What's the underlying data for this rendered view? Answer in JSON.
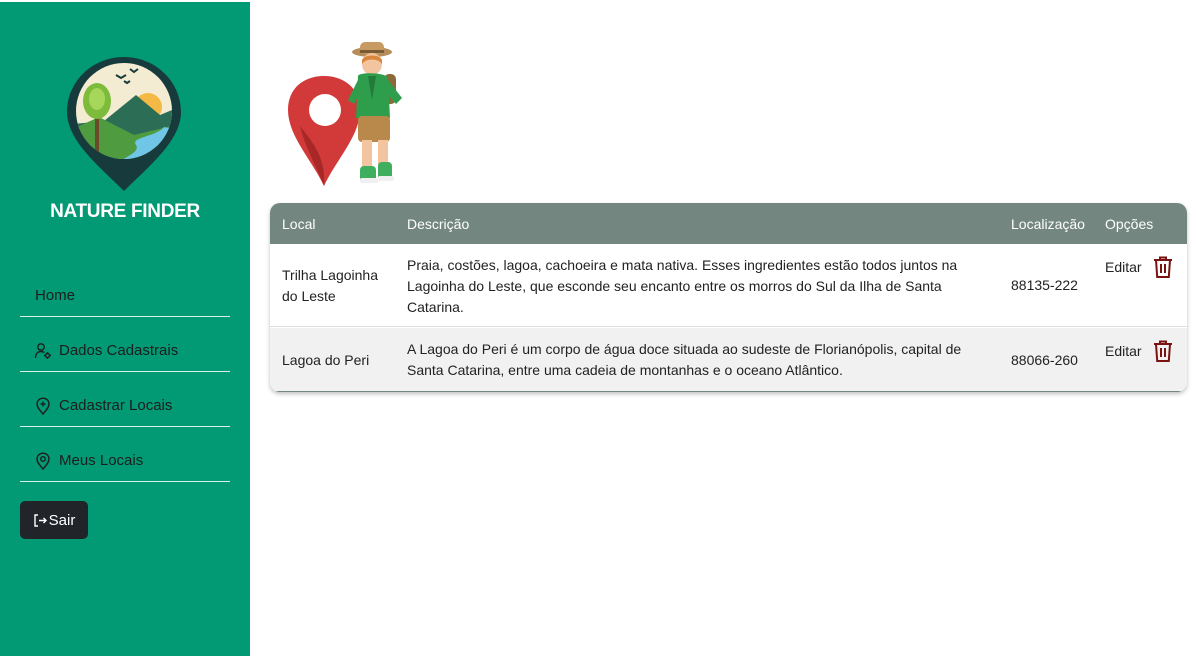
{
  "sidebar": {
    "brand": "NATURE FINDER",
    "items": [
      {
        "label": "Home",
        "icon": "none"
      },
      {
        "label": "Dados Cadastrais",
        "icon": "user-gear-icon"
      },
      {
        "label": "Cadastrar Locais",
        "icon": "add-location-icon"
      },
      {
        "label": "Meus Locais",
        "icon": "location-pin-icon"
      }
    ],
    "logout_label": "Sair"
  },
  "table": {
    "headers": {
      "local": "Local",
      "descricao": "Descrição",
      "localizacao": "Localização",
      "opcoes": "Opções"
    },
    "rows": [
      {
        "local": "Trilha Lagoinha do Leste",
        "descricao": "Praia, costões, lagoa, cachoeira e mata nativa. Esses ingredientes estão todos juntos na Lagoinha do Leste, que esconde seu encanto entre os morros do Sul da Ilha de Santa Catarina.",
        "localizacao": "88135-222",
        "edit_label": "Editar"
      },
      {
        "local": "Lagoa do Peri",
        "descricao": "A Lagoa do Peri é um corpo de água doce situada ao sudeste de Florianópolis, capital de Santa Catarina, entre uma cadeia de montanhas e o oceano Atlântico.",
        "localizacao": "88066-260",
        "edit_label": "Editar"
      }
    ]
  },
  "colors": {
    "sidebar_bg": "#029a75",
    "table_header_bg": "#738680",
    "logout_bg": "#212529",
    "trash_icon": "#7a1212"
  }
}
